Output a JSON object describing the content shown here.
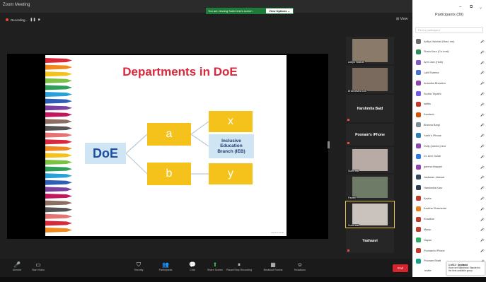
{
  "window": {
    "title": "Zoom Meeting"
  },
  "banner": {
    "text": "You are viewing Sukhi test's screen",
    "button": "View Options ⌄"
  },
  "recording": {
    "label": "Recording..."
  },
  "view": {
    "label": "View"
  },
  "slide": {
    "title": "Departments in DoE",
    "root": "DoE",
    "level1": [
      "a",
      "b"
    ],
    "level2_top": "x",
    "level2_mid": [
      "Inclusive",
      "Education",
      "Branch (IEB)"
    ],
    "level2_bottom": "y",
    "footer": "Depts in DoE",
    "colors": {
      "title": "#d9283b",
      "yellow": "#f4c21b",
      "blue_box": "#cfe5f3"
    }
  },
  "gallery": {
    "tiles": [
      {
        "name": "Aditya Vaishali",
        "kind": "video"
      },
      {
        "name": "BHAGWAN DAS",
        "kind": "video"
      },
      {
        "name": "Harshmita Baid",
        "kind": "name"
      },
      {
        "name": "Poonam's iPhone",
        "kind": "name"
      },
      {
        "name": "Sukhi test",
        "kind": "video"
      },
      {
        "name": "Pawan",
        "kind": "video"
      },
      {
        "name": "Sukhi test",
        "kind": "video"
      },
      {
        "name": "Yashasvi",
        "kind": "name"
      }
    ]
  },
  "panel": {
    "header": "Participants (39)",
    "search_placeholder": "Find a participant",
    "participants": [
      {
        "name": "Aditya Vaishali (Host, me)",
        "color": "#6b6b6b"
      },
      {
        "name": "Shalu Kaur (Co-host)",
        "color": "#2e8b57"
      },
      {
        "name": "Anhi Jain (Host)",
        "color": "#7d5cc6"
      },
      {
        "name": "Lalit Sharma",
        "color": "#4a6fd1"
      },
      {
        "name": "Anamika Bhavsha",
        "color": "#8e44ad"
      },
      {
        "name": "Sudha Tripathi",
        "color": "#6c5ce7"
      },
      {
        "name": "saltbs",
        "color": "#c0392b"
      },
      {
        "name": "Kamlesh",
        "color": "#d35400"
      },
      {
        "name": "Bhavna Bargi",
        "color": "#7f8c8d"
      },
      {
        "name": "Yazhi's iPhone",
        "color": "#2980b9"
      },
      {
        "name": "Dolly (Interim) test",
        "color": "#8e44ad"
      },
      {
        "name": "Dr. Avni Gulati",
        "color": "#2c7be5"
      },
      {
        "name": "garima bhayani",
        "color": "#8e44ad"
      },
      {
        "name": "Jaskaran Jaiswal",
        "color": "#34495e"
      },
      {
        "name": "Harshmita Kaur",
        "color": "#2c3e50"
      },
      {
        "name": "Kavita",
        "color": "#c0392b"
      },
      {
        "name": "Kavitha Dhashehal",
        "color": "#e67e22"
      },
      {
        "name": "Khadkoe",
        "color": "#c0392b"
      },
      {
        "name": "Manju",
        "color": "#c0392b"
      },
      {
        "name": "Nayan",
        "color": "#27ae60"
      },
      {
        "name": "Poonam's iPhone",
        "color": "#c0392b"
      },
      {
        "name": "Poonam Bhatt",
        "color": "#16a085"
      }
    ],
    "toast": {
      "title": "1 of 31 · Orphanid",
      "body": "Have set Stakeholdr Standed to the best available group"
    },
    "invite_label": "Invite"
  },
  "toolbar": {
    "items": [
      {
        "label": "Unmute",
        "icon": "mic-off-icon",
        "glyph": "🎤"
      },
      {
        "label": "Start Video",
        "icon": "video-off-icon",
        "glyph": "▭"
      },
      {
        "label": "Security",
        "icon": "shield-icon",
        "glyph": "⛉"
      },
      {
        "label": "Participants",
        "icon": "participants-icon",
        "glyph": "👥"
      },
      {
        "label": "Chat",
        "icon": "chat-icon",
        "glyph": "💬"
      },
      {
        "label": "Share Screen",
        "icon": "share-screen-icon",
        "glyph": "⬆"
      },
      {
        "label": "Pause/Stop Recording",
        "icon": "record-icon",
        "glyph": "⏸"
      },
      {
        "label": "Breakout Rooms",
        "icon": "breakout-icon",
        "glyph": "▦"
      },
      {
        "label": "Reactions",
        "icon": "reactions-icon",
        "glyph": "☺"
      }
    ],
    "end_label": "End"
  }
}
